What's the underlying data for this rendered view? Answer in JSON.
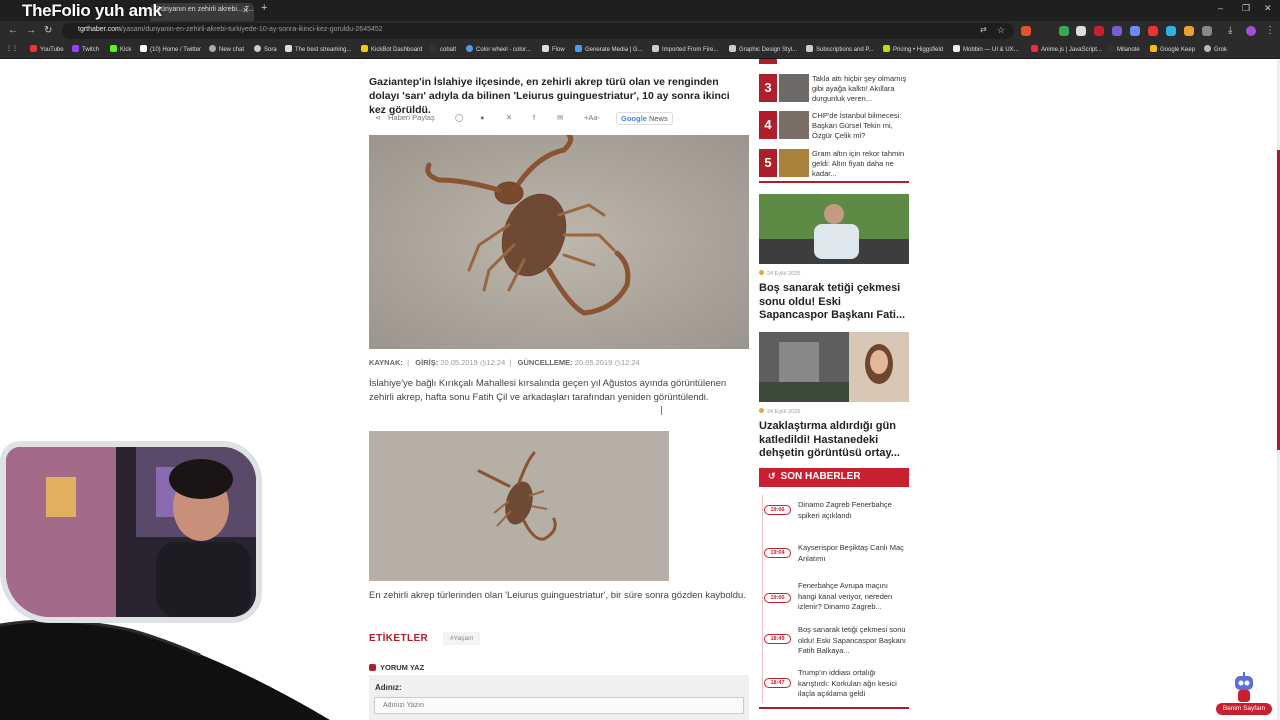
{
  "browser": {
    "overlay_title": "TheFolio yuh amk",
    "tab_title": "Dünyanın en zehirli akrebi... T...",
    "url_host": "tgrthaber.com",
    "url_path": "/yasam/dunyanin-en-zehirli-akrebi-turkiyede-10-ay-sonra-ikinci-kez-goruldu-2645452",
    "bookmarks": [
      "YouTube",
      "Twitch",
      "Kick",
      "(10) Home / Twitter",
      "New chat",
      "Sora",
      "The best streaming...",
      "KickBot Dashboard",
      "cobalt",
      "Color wheel - color...",
      "Flow",
      "Generate Media | G...",
      "Imported From Fire...",
      "Graphic Design Styl...",
      "Subscriptions and P...",
      "Pricing • Higgsfield",
      "Mobbin — UI & UX...",
      "Anime.js | JavaScript...",
      "Milanote",
      "Google Keep",
      "Grok"
    ]
  },
  "article": {
    "lead": "Gaziantep'in İslahiye ilçesinde, en zehirli akrep türü olan ve renginden dolayı 'sarı' adıyla da bilinen 'Leiurus guinguestriatur', 10 ay sonra ikinci kez görüldü.",
    "share_label": "Haberi Paylaş",
    "font_size_label": "+Aa-",
    "google_news": {
      "google": "Google",
      "news": "News"
    },
    "meta": {
      "source_label": "KAYNAK:",
      "entry_label": "GİRİŞ:",
      "entry_date": "20.05.2019",
      "entry_time": "12:24",
      "update_label": "GÜNCELLEME:",
      "update_date": "20.05.2019",
      "update_time": "12:24"
    },
    "paragraph1": "İslahiye'ye bağlı Kırıkçalı Mahallesi kırsalında geçen yıl Ağustos ayında görüntülenen zehirli akrep, hafta sonu Fatih Çil ve arkadaşları tarafından yeniden görüntülendi.",
    "paragraph2": "En zehirli akrep türlerinden olan 'Leiurus guinguestriatur', bir süre sonra gözden kayboldu.",
    "tags_title": "ETİKETLER",
    "tags": [
      "#Yaşam"
    ],
    "comment_title": "YORUM YAZ",
    "name_label": "Adınız:",
    "name_placeholder": "Adınızı Yazın"
  },
  "sidebar": {
    "ranked": [
      {
        "rank": "3",
        "text": "Takla attı hiçbir şey olmamış gibi ayağa kalktı! Akıllara durgunluk veren..."
      },
      {
        "rank": "4",
        "text": "CHP'de İstanbul bilmecesi: Başkan Gürsel Tekin mi, Özgür Çelik mi?"
      },
      {
        "rank": "5",
        "text": "Gram altın için rekor tahmin geldi: Altın fiyatı daha ne kadar..."
      }
    ],
    "featured": [
      {
        "date": "24 Eylül 2025",
        "title": "Boş sanarak tetiği çekmesi sonu oldu! Eski Sapancaspor Başkanı Fati..."
      },
      {
        "date": "24 Eylül 2025",
        "title": "Uzaklaştırma aldırdığı gün katledildi! Hastanedeki dehşetin görüntüsü ortay..."
      }
    ],
    "latest_title": "SON HABERLER",
    "latest": [
      {
        "time": "19:06",
        "text": "Dinamo Zagreb Fenerbahçe spikeri açıklandı"
      },
      {
        "time": "19:04",
        "text": "Kayserispor Beşiktaş Canlı Maç Anlatımı"
      },
      {
        "time": "19:00",
        "text": "Fenerbahçe Avrupa maçını hangi kanal veriyor, nereden izlenir? Dinamo Zagreb..."
      },
      {
        "time": "18:49",
        "text": "Boş sanarak tetiği çekmesi sonu oldu! Eski Sapancaspor Başkanı Fatih Balkaya..."
      },
      {
        "time": "18:47",
        "text": "Trump'ın iddiası ortalığı karıştırdı: Korkulan ağrı kesici ilaçla açıklama geldi"
      }
    ]
  },
  "mascot_label": "Benim Sayfam",
  "colors": {
    "accent": "#b01e2b",
    "accent_bright": "#c8202f",
    "date_dot": "#e8a33c"
  }
}
